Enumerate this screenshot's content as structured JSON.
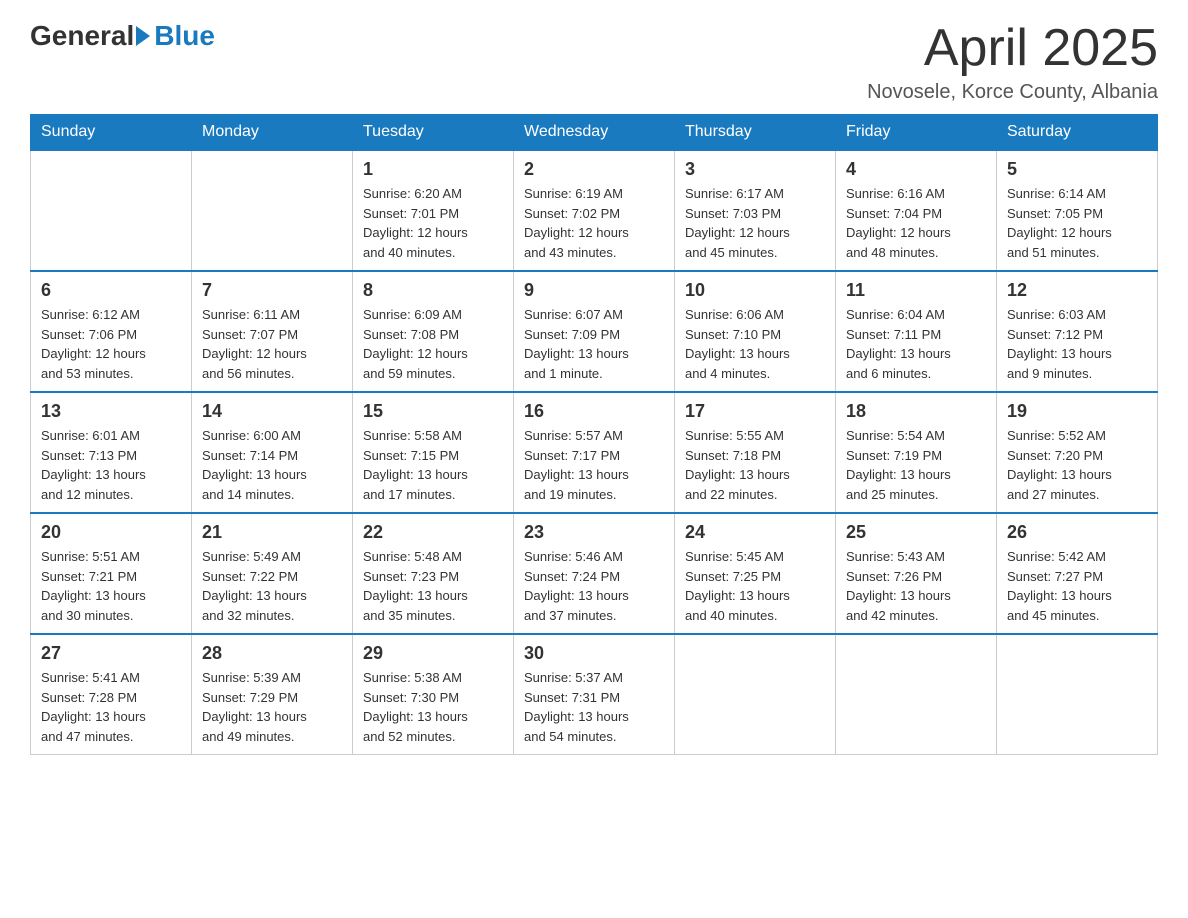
{
  "logo": {
    "general": "General",
    "blue": "Blue"
  },
  "title": {
    "month_year": "April 2025",
    "location": "Novosele, Korce County, Albania"
  },
  "weekdays": [
    "Sunday",
    "Monday",
    "Tuesday",
    "Wednesday",
    "Thursday",
    "Friday",
    "Saturday"
  ],
  "weeks": [
    [
      {
        "day": "",
        "info": ""
      },
      {
        "day": "",
        "info": ""
      },
      {
        "day": "1",
        "info": "Sunrise: 6:20 AM\nSunset: 7:01 PM\nDaylight: 12 hours\nand 40 minutes."
      },
      {
        "day": "2",
        "info": "Sunrise: 6:19 AM\nSunset: 7:02 PM\nDaylight: 12 hours\nand 43 minutes."
      },
      {
        "day": "3",
        "info": "Sunrise: 6:17 AM\nSunset: 7:03 PM\nDaylight: 12 hours\nand 45 minutes."
      },
      {
        "day": "4",
        "info": "Sunrise: 6:16 AM\nSunset: 7:04 PM\nDaylight: 12 hours\nand 48 minutes."
      },
      {
        "day": "5",
        "info": "Sunrise: 6:14 AM\nSunset: 7:05 PM\nDaylight: 12 hours\nand 51 minutes."
      }
    ],
    [
      {
        "day": "6",
        "info": "Sunrise: 6:12 AM\nSunset: 7:06 PM\nDaylight: 12 hours\nand 53 minutes."
      },
      {
        "day": "7",
        "info": "Sunrise: 6:11 AM\nSunset: 7:07 PM\nDaylight: 12 hours\nand 56 minutes."
      },
      {
        "day": "8",
        "info": "Sunrise: 6:09 AM\nSunset: 7:08 PM\nDaylight: 12 hours\nand 59 minutes."
      },
      {
        "day": "9",
        "info": "Sunrise: 6:07 AM\nSunset: 7:09 PM\nDaylight: 13 hours\nand 1 minute."
      },
      {
        "day": "10",
        "info": "Sunrise: 6:06 AM\nSunset: 7:10 PM\nDaylight: 13 hours\nand 4 minutes."
      },
      {
        "day": "11",
        "info": "Sunrise: 6:04 AM\nSunset: 7:11 PM\nDaylight: 13 hours\nand 6 minutes."
      },
      {
        "day": "12",
        "info": "Sunrise: 6:03 AM\nSunset: 7:12 PM\nDaylight: 13 hours\nand 9 minutes."
      }
    ],
    [
      {
        "day": "13",
        "info": "Sunrise: 6:01 AM\nSunset: 7:13 PM\nDaylight: 13 hours\nand 12 minutes."
      },
      {
        "day": "14",
        "info": "Sunrise: 6:00 AM\nSunset: 7:14 PM\nDaylight: 13 hours\nand 14 minutes."
      },
      {
        "day": "15",
        "info": "Sunrise: 5:58 AM\nSunset: 7:15 PM\nDaylight: 13 hours\nand 17 minutes."
      },
      {
        "day": "16",
        "info": "Sunrise: 5:57 AM\nSunset: 7:17 PM\nDaylight: 13 hours\nand 19 minutes."
      },
      {
        "day": "17",
        "info": "Sunrise: 5:55 AM\nSunset: 7:18 PM\nDaylight: 13 hours\nand 22 minutes."
      },
      {
        "day": "18",
        "info": "Sunrise: 5:54 AM\nSunset: 7:19 PM\nDaylight: 13 hours\nand 25 minutes."
      },
      {
        "day": "19",
        "info": "Sunrise: 5:52 AM\nSunset: 7:20 PM\nDaylight: 13 hours\nand 27 minutes."
      }
    ],
    [
      {
        "day": "20",
        "info": "Sunrise: 5:51 AM\nSunset: 7:21 PM\nDaylight: 13 hours\nand 30 minutes."
      },
      {
        "day": "21",
        "info": "Sunrise: 5:49 AM\nSunset: 7:22 PM\nDaylight: 13 hours\nand 32 minutes."
      },
      {
        "day": "22",
        "info": "Sunrise: 5:48 AM\nSunset: 7:23 PM\nDaylight: 13 hours\nand 35 minutes."
      },
      {
        "day": "23",
        "info": "Sunrise: 5:46 AM\nSunset: 7:24 PM\nDaylight: 13 hours\nand 37 minutes."
      },
      {
        "day": "24",
        "info": "Sunrise: 5:45 AM\nSunset: 7:25 PM\nDaylight: 13 hours\nand 40 minutes."
      },
      {
        "day": "25",
        "info": "Sunrise: 5:43 AM\nSunset: 7:26 PM\nDaylight: 13 hours\nand 42 minutes."
      },
      {
        "day": "26",
        "info": "Sunrise: 5:42 AM\nSunset: 7:27 PM\nDaylight: 13 hours\nand 45 minutes."
      }
    ],
    [
      {
        "day": "27",
        "info": "Sunrise: 5:41 AM\nSunset: 7:28 PM\nDaylight: 13 hours\nand 47 minutes."
      },
      {
        "day": "28",
        "info": "Sunrise: 5:39 AM\nSunset: 7:29 PM\nDaylight: 13 hours\nand 49 minutes."
      },
      {
        "day": "29",
        "info": "Sunrise: 5:38 AM\nSunset: 7:30 PM\nDaylight: 13 hours\nand 52 minutes."
      },
      {
        "day": "30",
        "info": "Sunrise: 5:37 AM\nSunset: 7:31 PM\nDaylight: 13 hours\nand 54 minutes."
      },
      {
        "day": "",
        "info": ""
      },
      {
        "day": "",
        "info": ""
      },
      {
        "day": "",
        "info": ""
      }
    ]
  ]
}
